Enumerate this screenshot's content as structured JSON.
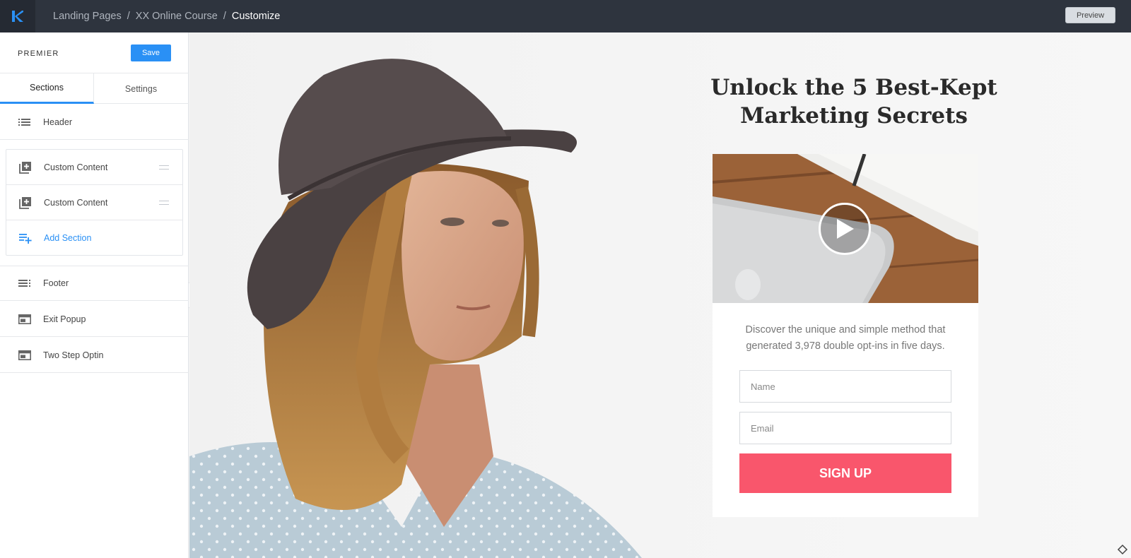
{
  "topbar": {
    "breadcrumbs": [
      "Landing Pages",
      "XX Online Course",
      "Customize"
    ],
    "separator": "/",
    "preview_label": "Preview",
    "logo_icon": "k-logo-icon"
  },
  "sidebar": {
    "brand": "PREMIER",
    "save_label": "Save",
    "tabs": [
      {
        "label": "Sections",
        "active": true
      },
      {
        "label": "Settings",
        "active": false
      }
    ],
    "header_item": {
      "label": "Header",
      "icon": "list-icon"
    },
    "group_items": [
      {
        "label": "Custom Content",
        "icon": "add-box-icon"
      },
      {
        "label": "Custom Content",
        "icon": "add-box-icon"
      }
    ],
    "add_section": {
      "label": "Add Section",
      "icon": "playlist-add-icon"
    },
    "bottom_items": [
      {
        "label": "Footer",
        "icon": "footer-list-icon"
      },
      {
        "label": "Exit Popup",
        "icon": "window-icon"
      },
      {
        "label": "Two Step Optin",
        "icon": "window-icon"
      }
    ]
  },
  "page": {
    "headline": "Unlock the 5 Best-Kept Marketing Secrets",
    "description": "Discover the unique and simple method that generated 3,978 double opt-ins in five days.",
    "name_placeholder": "Name",
    "email_placeholder": "Email",
    "signup_label": "SIGN UP"
  },
  "colors": {
    "accent": "#2a90f5",
    "topbar": "#2e343e",
    "signup": "#f9566c"
  }
}
